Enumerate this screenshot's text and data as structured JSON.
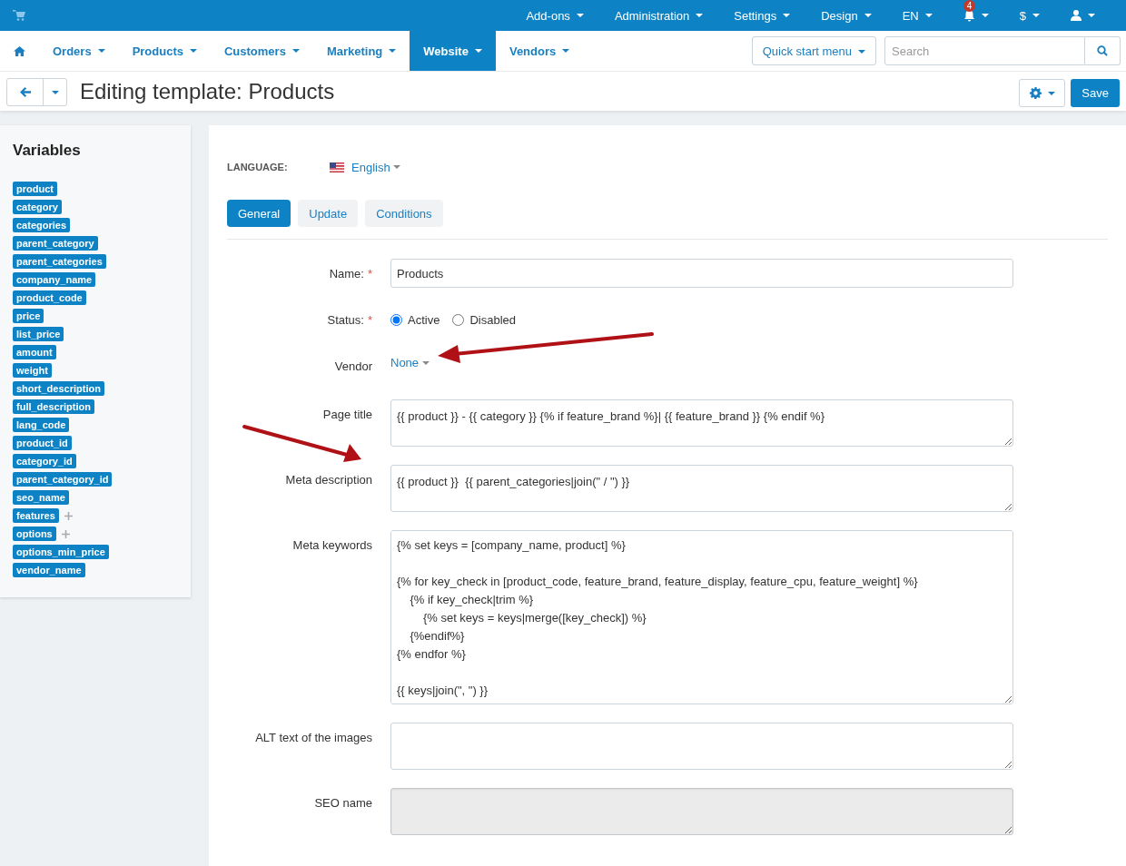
{
  "top_menu": [
    {
      "kind": "text",
      "label": "Add-ons"
    },
    {
      "kind": "text",
      "label": "Administration"
    },
    {
      "kind": "text",
      "label": "Settings"
    },
    {
      "kind": "text",
      "label": "Design"
    },
    {
      "kind": "text",
      "label": "EN"
    },
    {
      "kind": "bell",
      "badge": "4"
    },
    {
      "kind": "text",
      "label": "$"
    },
    {
      "kind": "user"
    }
  ],
  "nav": {
    "items": [
      {
        "label": "Orders",
        "selected": false
      },
      {
        "label": "Products",
        "selected": false
      },
      {
        "label": "Customers",
        "selected": false
      },
      {
        "label": "Marketing",
        "selected": false
      },
      {
        "label": "Website",
        "selected": true
      },
      {
        "label": "Vendors",
        "selected": false
      }
    ],
    "quick_start": "Quick start menu",
    "search": {
      "placeholder": "Search"
    }
  },
  "header": {
    "title": "Editing template: Products",
    "save": "Save"
  },
  "sidebar": {
    "title": "Variables",
    "variables": [
      {
        "name": "product",
        "expandable": false
      },
      {
        "name": "category",
        "expandable": false
      },
      {
        "name": "categories",
        "expandable": false
      },
      {
        "name": "parent_category",
        "expandable": false
      },
      {
        "name": "parent_categories",
        "expandable": false
      },
      {
        "name": "company_name",
        "expandable": false
      },
      {
        "name": "product_code",
        "expandable": false
      },
      {
        "name": "price",
        "expandable": false
      },
      {
        "name": "list_price",
        "expandable": false
      },
      {
        "name": "amount",
        "expandable": false
      },
      {
        "name": "weight",
        "expandable": false
      },
      {
        "name": "short_description",
        "expandable": false
      },
      {
        "name": "full_description",
        "expandable": false
      },
      {
        "name": "lang_code",
        "expandable": false
      },
      {
        "name": "product_id",
        "expandable": false
      },
      {
        "name": "category_id",
        "expandable": false
      },
      {
        "name": "parent_category_id",
        "expandable": false
      },
      {
        "name": "seo_name",
        "expandable": false
      },
      {
        "name": "features",
        "expandable": true
      },
      {
        "name": "options",
        "expandable": true
      },
      {
        "name": "options_min_price",
        "expandable": false
      },
      {
        "name": "vendor_name",
        "expandable": false
      }
    ]
  },
  "form": {
    "language_label": "LANGUAGE:",
    "language": "English",
    "tabs": [
      {
        "label": "General",
        "selected": true
      },
      {
        "label": "Update",
        "selected": false
      },
      {
        "label": "Conditions",
        "selected": false
      }
    ],
    "fields": [
      {
        "kind": "text",
        "label": "Name:",
        "required_mark": "*",
        "value": "Products",
        "disabled": false
      },
      {
        "kind": "radio",
        "label": "Status:",
        "required_mark": "*",
        "options": [
          {
            "label": "Active",
            "selected": true
          },
          {
            "label": "Disabled",
            "selected": false
          }
        ]
      },
      {
        "kind": "select",
        "label": "Vendor",
        "value": "None"
      },
      {
        "kind": "textarea",
        "label": "Page title",
        "value": "{{ product }} - {{ category }} {% if feature_brand %}| {{ feature_brand }} {% endif %}",
        "disabled": false
      },
      {
        "kind": "textarea",
        "label": "Meta description",
        "value": "{{ product }}  {{ parent_categories|join(\" / \") }}",
        "disabled": false
      },
      {
        "kind": "textarea",
        "label": "Meta keywords",
        "value": "{% set keys = [company_name, product] %}\n\n{% for key_check in [product_code, feature_brand, feature_display, feature_cpu, feature_weight] %}\n    {% if key_check|trim %}\n        {% set keys = keys|merge([key_check]) %}\n    {%endif%}\n{% endfor %}\n\n{{ keys|join(\", \") }}",
        "disabled": false,
        "tall": true
      },
      {
        "kind": "textarea",
        "label": "ALT text of the images",
        "disabled": false
      },
      {
        "kind": "textarea",
        "label": "SEO name",
        "disabled": true
      }
    ]
  }
}
